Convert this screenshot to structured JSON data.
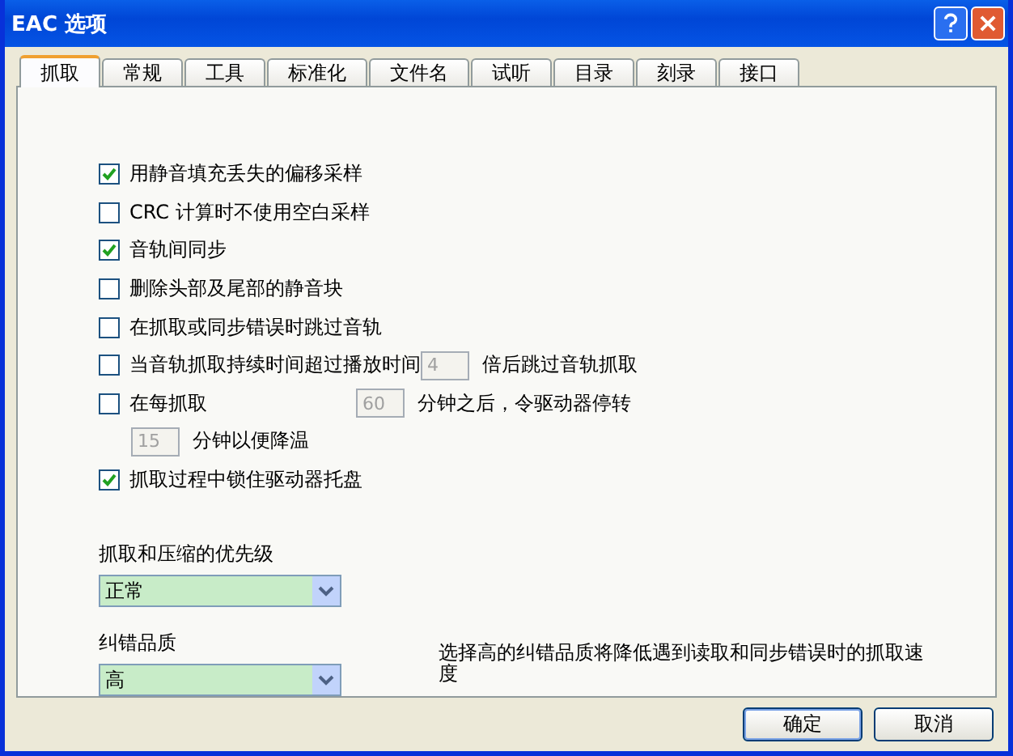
{
  "window": {
    "title": "EAC 选项"
  },
  "tabs": [
    {
      "label": "抓取",
      "selected": true
    },
    {
      "label": "常规",
      "selected": false
    },
    {
      "label": "工具",
      "selected": false
    },
    {
      "label": "标准化",
      "selected": false
    },
    {
      "label": "文件名",
      "selected": false
    },
    {
      "label": "试听",
      "selected": false
    },
    {
      "label": "目录",
      "selected": false
    },
    {
      "label": "刻录",
      "selected": false
    },
    {
      "label": "接口",
      "selected": false
    }
  ],
  "options": [
    {
      "kind": "check",
      "label": "用静音填充丢失的偏移采样",
      "checked": true
    },
    {
      "kind": "check",
      "label": "CRC 计算时不使用空白采样",
      "checked": false
    },
    {
      "kind": "check",
      "label": "音轨间同步",
      "checked": true
    },
    {
      "kind": "check",
      "label": "删除头部及尾部的静音块",
      "checked": false
    },
    {
      "kind": "check",
      "label": "在抓取或同步错误时跳过音轨",
      "checked": false
    },
    {
      "kind": "check-field",
      "label": "当音轨抓取持续时间超过播放时间",
      "checked": false,
      "value": "4",
      "suffix": "倍后跳过音轨抓取"
    },
    {
      "kind": "check-field",
      "label": "在每抓取",
      "checked": false,
      "value": "60",
      "suffix": "分钟之后，令驱动器停转"
    },
    {
      "kind": "field",
      "value": "15",
      "suffix": "分钟以便降温"
    },
    {
      "kind": "check",
      "label": "抓取过程中锁住驱动器托盘",
      "checked": true
    }
  ],
  "priority": {
    "label": "抓取和压缩的优先级",
    "value": "正常"
  },
  "quality": {
    "label": "纠错品质",
    "value": "高",
    "note": "选择高的纠错品质将降低遇到读取和同步错误时的抓取速度"
  },
  "buttons": [
    "确定",
    "取消"
  ]
}
